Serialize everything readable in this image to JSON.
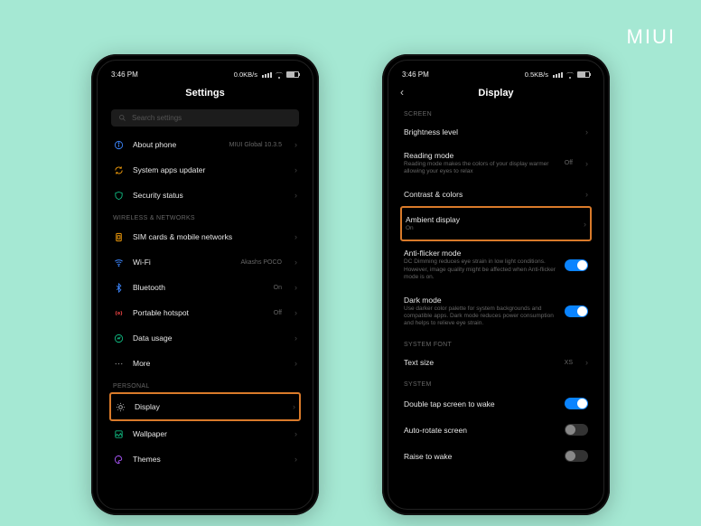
{
  "brand": "MIUI",
  "status": {
    "time": "3:46 PM",
    "net_left": "0.0KB/s",
    "net_right": "0.5KB/s"
  },
  "left": {
    "title": "Settings",
    "search_placeholder": "Search settings",
    "about": {
      "label": "About phone",
      "value": "MIUI Global 10.3.5"
    },
    "updater": {
      "label": "System apps updater"
    },
    "security": {
      "label": "Security status"
    },
    "section_wireless": "WIRELESS & NETWORKS",
    "sim": {
      "label": "SIM cards & mobile networks"
    },
    "wifi": {
      "label": "Wi-Fi",
      "value": "Akashs POCO"
    },
    "bluetooth": {
      "label": "Bluetooth",
      "value": "On"
    },
    "hotspot": {
      "label": "Portable hotspot",
      "value": "Off"
    },
    "data": {
      "label": "Data usage"
    },
    "more": {
      "label": "More"
    },
    "section_personal": "PERSONAL",
    "display": {
      "label": "Display"
    },
    "wallpaper": {
      "label": "Wallpaper"
    },
    "themes": {
      "label": "Themes"
    }
  },
  "right": {
    "title": "Display",
    "section_screen": "SCREEN",
    "brightness": {
      "label": "Brightness level"
    },
    "reading": {
      "label": "Reading mode",
      "sub": "Reading mode makes the colors of your display warmer allowing your eyes to relax",
      "value": "Off"
    },
    "contrast": {
      "label": "Contrast & colors"
    },
    "ambient": {
      "label": "Ambient display",
      "sub": "On"
    },
    "antiflicker": {
      "label": "Anti-flicker mode",
      "sub": "DC Dimming reduces eye strain in low light conditions. However, image quality might be affected when Anti-flicker mode is on."
    },
    "darkmode": {
      "label": "Dark mode",
      "sub": "Use darker color palette for system backgrounds and compatible apps. Dark mode reduces power consumption and helps to relieve eye strain."
    },
    "section_font": "SYSTEM FONT",
    "textsize": {
      "label": "Text size",
      "value": "XS"
    },
    "section_system": "SYSTEM",
    "doubletap": {
      "label": "Double tap screen to wake"
    },
    "autorotate": {
      "label": "Auto-rotate screen"
    },
    "raise": {
      "label": "Raise to wake"
    }
  }
}
